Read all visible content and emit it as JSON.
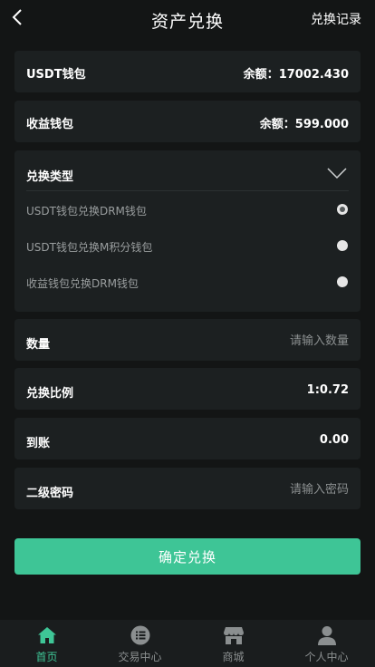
{
  "header": {
    "title": "资产兑换",
    "record_link": "兑换记录"
  },
  "wallets": [
    {
      "label": "USDT钱包",
      "balance_label": "余额：",
      "balance": "17002.430"
    },
    {
      "label": "收益钱包",
      "balance_label": "余额：",
      "balance": "599.000"
    }
  ],
  "exchange_type": {
    "label": "兑换类型",
    "options": [
      {
        "label": "USDT钱包兑换DRM钱包",
        "selected": true
      },
      {
        "label": "USDT钱包兑换M积分钱包",
        "selected": false
      },
      {
        "label": "收益钱包兑换DRM钱包",
        "selected": false
      }
    ]
  },
  "form": {
    "quantity_label": "数量",
    "quantity_placeholder": "请输入数量",
    "ratio_label": "兑换比例",
    "ratio_value": "1:0.72",
    "arrival_label": "到账",
    "arrival_value": "0.00",
    "password_label": "二级密码",
    "password_placeholder": "请输入密码"
  },
  "confirm_button": "确定兑换",
  "tabbar": [
    {
      "label": "首页",
      "icon": "home-icon",
      "active": true
    },
    {
      "label": "交易中心",
      "icon": "list-icon",
      "active": false
    },
    {
      "label": "商城",
      "icon": "shop-icon",
      "active": false
    },
    {
      "label": "个人中心",
      "icon": "user-icon",
      "active": false
    }
  ],
  "colors": {
    "accent": "#3ec596",
    "background": "#131515",
    "card": "#1c2021",
    "muted_text": "#8b8f90"
  }
}
